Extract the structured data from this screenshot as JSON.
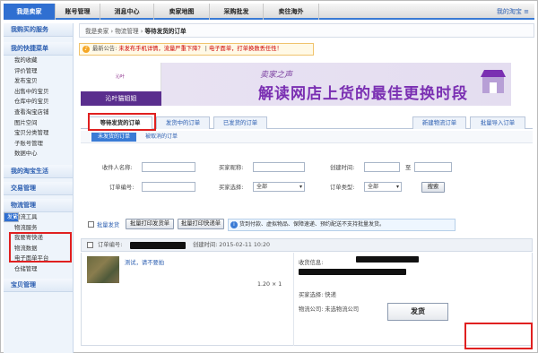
{
  "topnav": {
    "tabs": [
      "我是卖家",
      "账号管理",
      "消息中心",
      "卖家地图",
      "采购批发",
      "卖往海外"
    ],
    "active": 0,
    "right_link": "我的淘宝 ≡"
  },
  "sidebar": {
    "section1": "我购买的服务",
    "section2": "我的快捷菜单",
    "quick_items": [
      "我的收藏",
      "评价管理",
      "发布宝贝",
      "出售中的宝贝",
      "仓库中的宝贝",
      "查看淘宝店铺",
      "图片空间",
      "宝贝分类管理",
      "子账号管理",
      "数据中心"
    ],
    "section3": "我的淘宝生活",
    "section4": "交易管理",
    "section5": "物流管理",
    "logistics_items": [
      "发货",
      "物流工具",
      "物流服务",
      "我要寄快递",
      "物流数据",
      "电子面单平台",
      "仓储管理"
    ],
    "section6": "宝贝管理"
  },
  "breadcrumb": {
    "root": "我是卖家",
    "mid": "物流管理",
    "current": "等待发货的订单"
  },
  "notice": {
    "prefix": "最新公告:",
    "text": "未发布手机详情，流量严重下降？",
    "sep": "|",
    "text2": "电子面单，打单换数丢任性！"
  },
  "banner": {
    "logo_mark": "沁叶",
    "shop_name": "沁叶猫姐姐",
    "subtitle": "卖家之声",
    "headline": "解读网店上货的最佳更换时段"
  },
  "tabs": {
    "items": [
      "等待发货的订单",
      "发货中的订单",
      "已发货的订单"
    ],
    "right": [
      "新建物流订单",
      "批量导入订单"
    ]
  },
  "subbar": {
    "pill": "未发货的订单",
    "link": "被取消的订单"
  },
  "filters": {
    "recipient_label": "收件人名称:",
    "buyer_label": "买家昵称:",
    "created_label": "创建时间:",
    "to_label": "至",
    "order_no_label": "订单编号:",
    "buyer_select_label": "买家选择:",
    "buyer_select_value": "全部",
    "order_type_label": "订单类型:",
    "order_type_value": "全部",
    "search": "搜索"
  },
  "actions": {
    "batch": "批量发货",
    "print_ship": "批量打印发货单",
    "print_express": "批量打印快递单",
    "info": "货到付款、虚拟物品、保障速递、预约配送不支持批量发货。"
  },
  "order": {
    "order_no_label": "订单编号:",
    "created": "创建时间: 2015-02-11 10:20",
    "product": "测试，请不要拍",
    "price_qty": "1.20 × 1",
    "recv_label": "收货信息:",
    "buyer_choice": "买家选择: 快递",
    "logistics": "物流公司: 未选物流公司",
    "ship": "发货"
  },
  "colors": {
    "accent": "#2f6fd1",
    "highlight": "#e02020",
    "banner_text": "#7a2fb2"
  }
}
